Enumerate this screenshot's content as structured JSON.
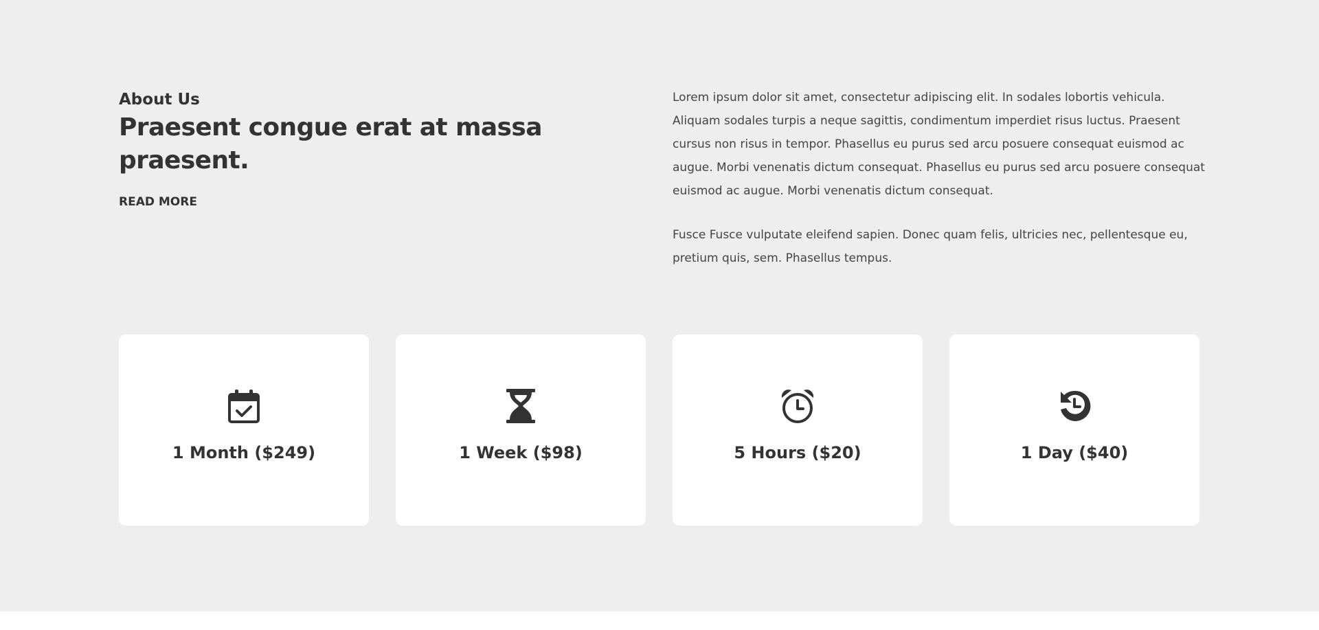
{
  "about": {
    "eyebrow": "About Us",
    "headline": "Praesent congue erat at massa praesent.",
    "read_more": "READ MORE",
    "paragraphs": [
      "Lorem ipsum dolor sit amet, consectetur adipiscing elit. In sodales lobortis vehicula. Aliquam sodales turpis a neque sagittis, condimentum imperdiet risus luctus. Praesent cursus non risus in tempor. Phasellus eu purus sed arcu posuere consequat euismod ac augue. Morbi venenatis dictum consequat. Phasellus eu purus sed arcu posuere consequat euismod ac augue. Morbi venenatis dictum consequat.",
      "Fusce Fusce vulputate eleifend sapien. Donec quam felis, ultricies nec, pellentesque eu, pretium quis, sem. Phasellus tempus."
    ]
  },
  "plans": [
    {
      "label": "1 Month ($249)",
      "icon": "calendar-check-icon"
    },
    {
      "label": "1 Week ($98)",
      "icon": "hourglass-icon"
    },
    {
      "label": "5 Hours ($20)",
      "icon": "alarm-clock-icon"
    },
    {
      "label": "1 Day ($40)",
      "icon": "history-icon"
    }
  ],
  "colors": {
    "section_background": "#eeeeee",
    "card_background": "#ffffff",
    "text": "#333333"
  }
}
